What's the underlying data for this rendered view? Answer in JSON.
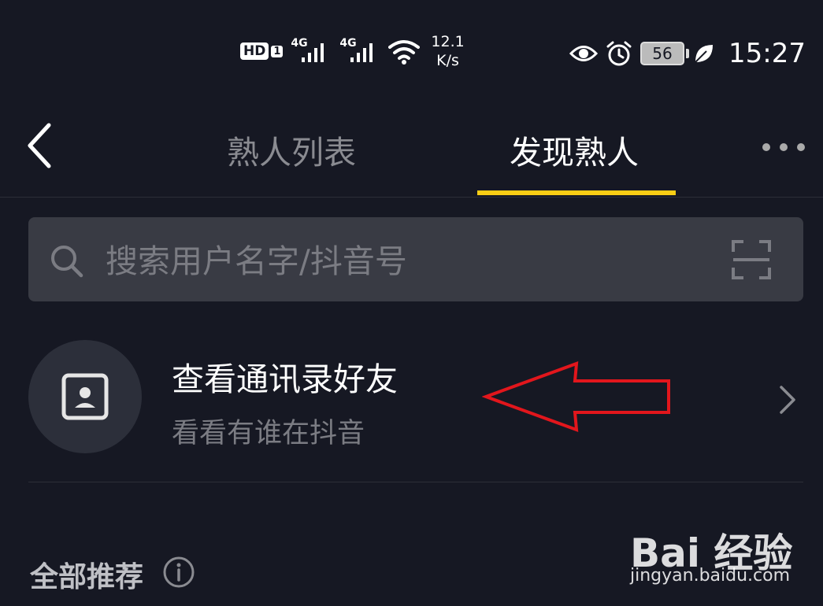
{
  "status_bar": {
    "hd": "HD",
    "sim": "1",
    "net1": "4G",
    "net2": "4G",
    "speed_value": "12.1",
    "speed_unit": "K/s",
    "battery": "56",
    "time": "15:27"
  },
  "nav": {
    "tabs": [
      {
        "label": "熟人列表",
        "active": false
      },
      {
        "label": "发现熟人",
        "active": true
      }
    ],
    "accent_color": "#face15"
  },
  "search": {
    "placeholder": "搜索用户名字/抖音号"
  },
  "contacts_entry": {
    "title": "查看通讯录好友",
    "subtitle": "看看有谁在抖音"
  },
  "section": {
    "title": "全部推荐"
  },
  "watermark": {
    "logo": "Bai 经验",
    "url": "jingyan.baidu.com"
  }
}
